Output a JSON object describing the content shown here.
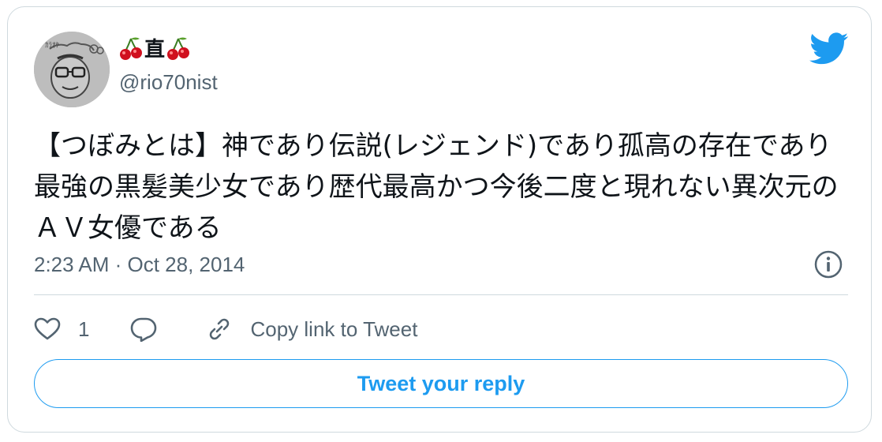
{
  "author": {
    "display_name": "直",
    "name_decoration_icon": "cherry-emoji",
    "handle": "@rio70nist",
    "avatar_icon": "caricature-avatar"
  },
  "platform_icon": "twitter-bird-icon",
  "colors": {
    "accent": "#1d9bf0",
    "secondary_text": "#536471",
    "border": "#cfd9de",
    "text": "#0f1419"
  },
  "tweet": {
    "text": "【つぼみとは】神であり伝説(レジェンド)であり孤高の存在であり最強の黒髪美少女であり歴代最高かつ今後二度と現れない異次元のＡＶ女優である",
    "timestamp": "2:23 AM · Oct 28, 2014"
  },
  "actions": {
    "like_count": "1",
    "copy_link_label": "Copy link to Tweet"
  },
  "reply_button_label": "Tweet your reply"
}
